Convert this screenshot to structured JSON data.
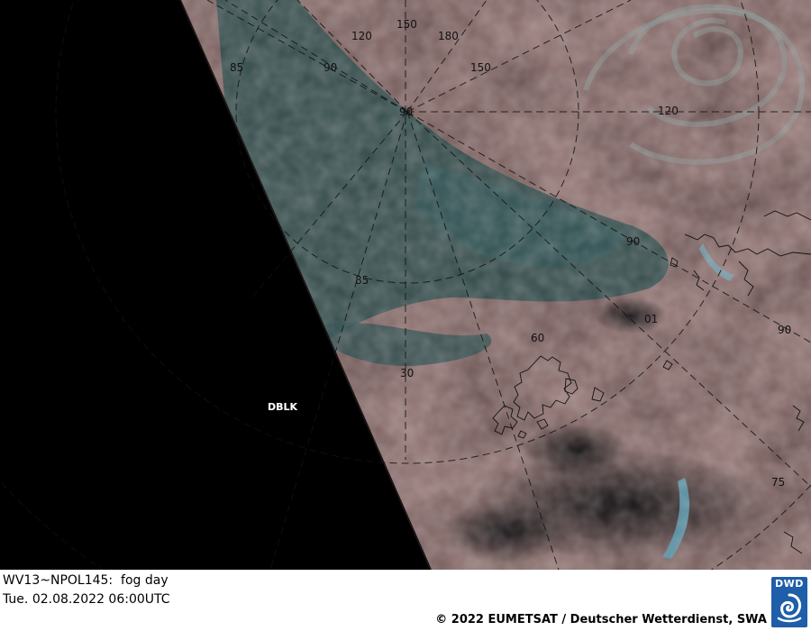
{
  "image": {
    "grid_labels": [
      "150",
      "120",
      "180",
      "85",
      "90",
      "150",
      "90",
      "120",
      "90",
      "85",
      "01",
      "90",
      "60",
      "30",
      "75"
    ],
    "stamp": "DBLK",
    "colors": {
      "night_side": "#000000",
      "cloud_pink": "#6e4f4c",
      "fog_teal": "#2c4a4a",
      "gridline": "#1a1a1a"
    }
  },
  "footer": {
    "caption_line1": "WV13~NPOL145:  fog day",
    "caption_line2": "Tue. 02.08.2022 06:00UTC",
    "copyright": "© 2022 EUMETSAT / Deutscher Wetterdienst, SWA",
    "logo_text": "DWD",
    "logo_color": "#1f5ea8"
  }
}
